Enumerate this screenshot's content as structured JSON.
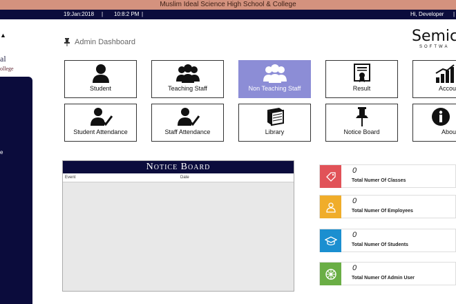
{
  "header": {
    "school_name": "Muslim Ideal Science High School & College",
    "date": "19:Jan:2018",
    "separator": "|",
    "time": "10:8:2 PM",
    "greeting": "Hi, Developer",
    "separator2": "|"
  },
  "sidebar": {
    "logo_line1": "al",
    "logo_line2": "ollege",
    "item_label": "e"
  },
  "page": {
    "title": "Admin Dashboard",
    "brand": "Semico",
    "brand_sub": "SOFTWA"
  },
  "tiles": [
    {
      "label": "Student",
      "icon": "user-icon"
    },
    {
      "label": "Teaching Staff",
      "icon": "users-icon"
    },
    {
      "label": "Non Teaching Staff",
      "icon": "users-icon"
    },
    {
      "label": "Result",
      "icon": "certificate-icon"
    },
    {
      "label": "Accou",
      "icon": "chart-icon"
    },
    {
      "label": "Student Attendance",
      "icon": "attendance-icon"
    },
    {
      "label": "Staff Attendance",
      "icon": "attendance-icon"
    },
    {
      "label": "Library",
      "icon": "book-icon"
    },
    {
      "label": "Notice Board",
      "icon": "pin-icon"
    },
    {
      "label": "Abou",
      "icon": "info-icon"
    }
  ],
  "notice_board": {
    "title": "Notice Board",
    "col_event": "Event",
    "col_date": "Date"
  },
  "stats": [
    {
      "value": "0",
      "caption": "Total Numer Of Classes",
      "color": "#e15258",
      "icon": "tag-icon"
    },
    {
      "value": "0",
      "caption": "Total Numer Of Employees",
      "color": "#f0ad2a",
      "icon": "person-icon"
    },
    {
      "value": "0",
      "caption": "Total Numer Of Students",
      "color": "#1b8fd0",
      "icon": "graduation-cap-icon"
    },
    {
      "value": "0",
      "caption": "Total Numer Of Admin User",
      "color": "#6aae45",
      "icon": "wheel-icon"
    }
  ],
  "colors": {
    "topbar": "#d4927e",
    "navy": "#0b0c3c",
    "active_tile": "#8c8dd6"
  }
}
